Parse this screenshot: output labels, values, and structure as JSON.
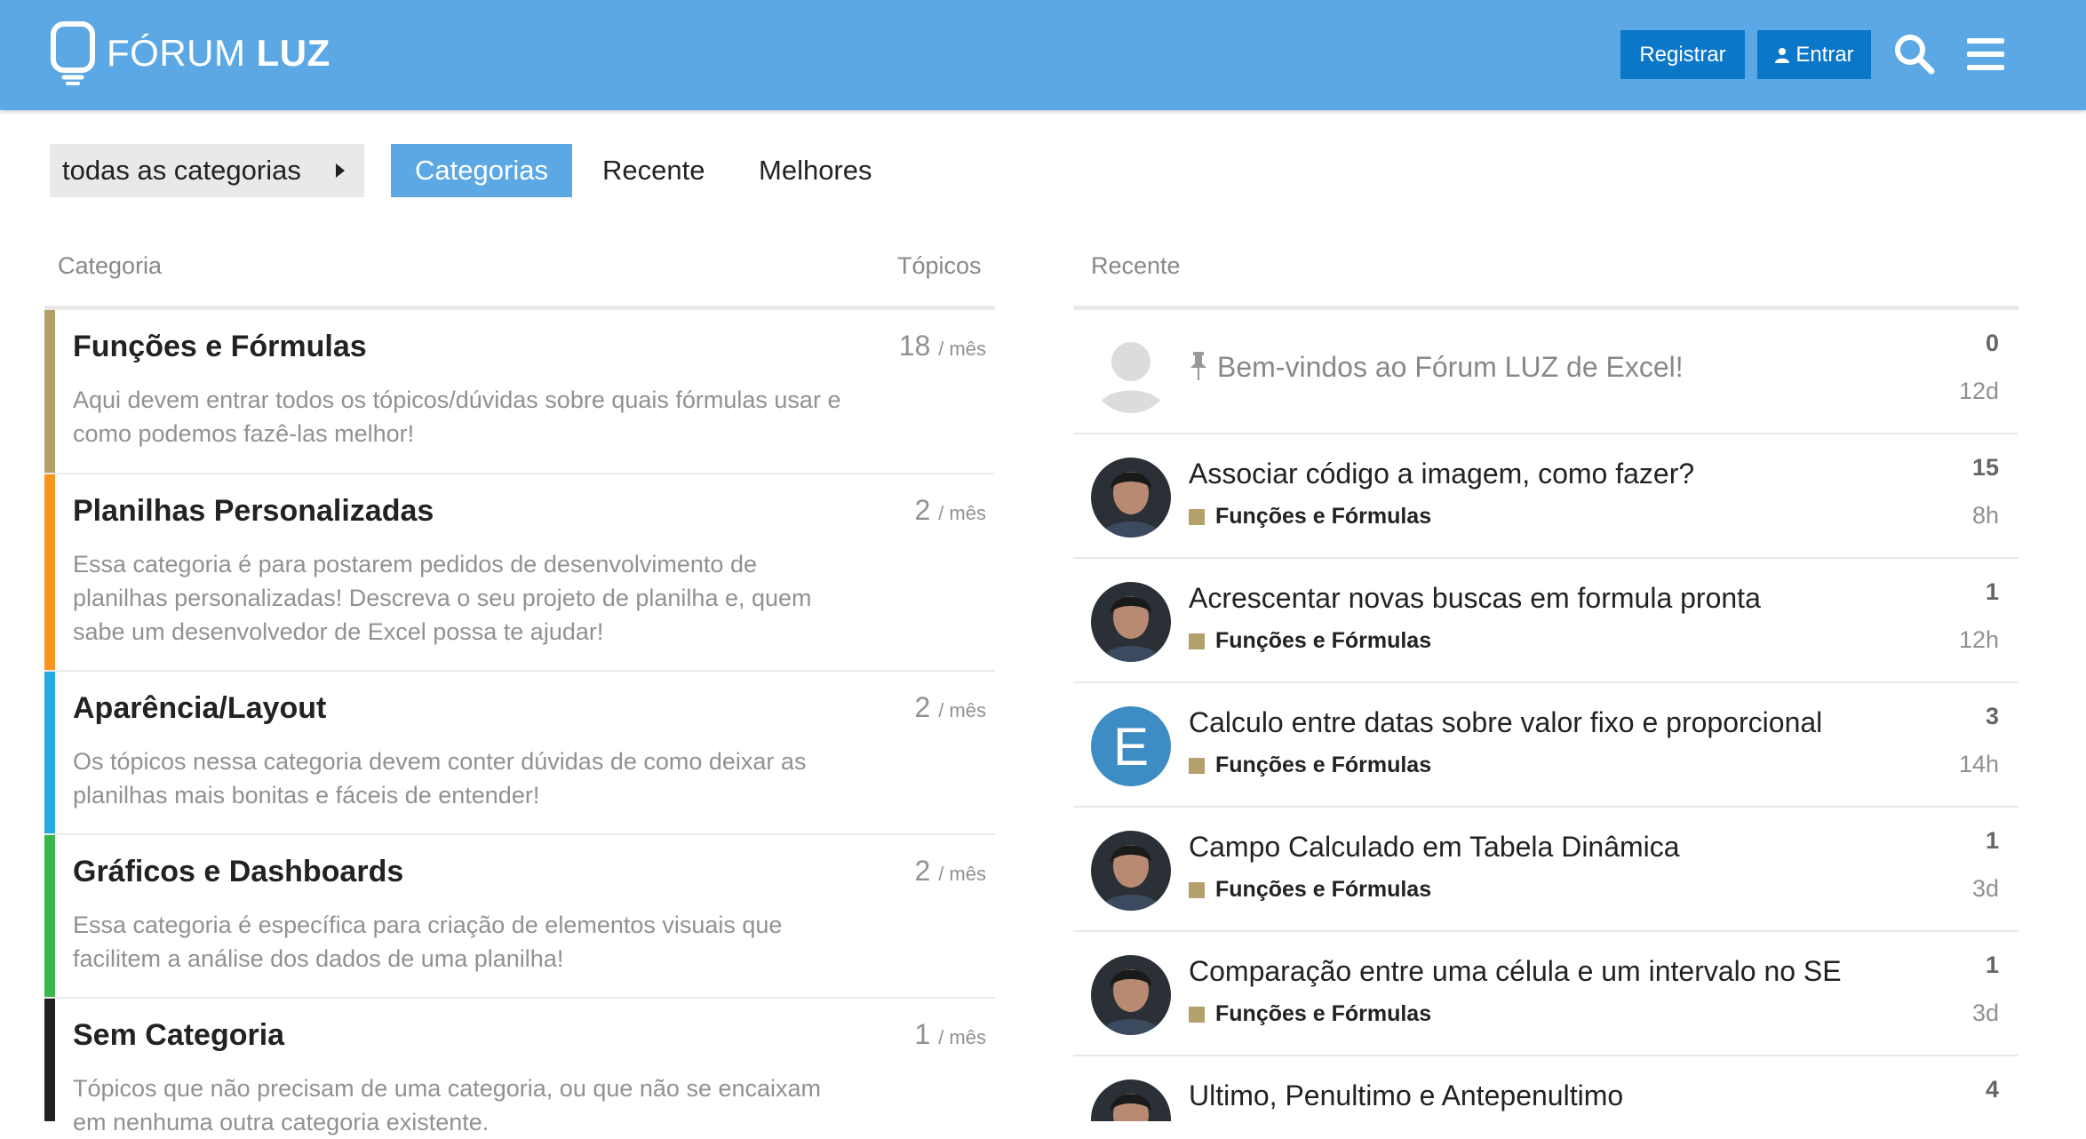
{
  "header": {
    "logo_text_light": "FÓRUM",
    "logo_text_bold": "LUZ",
    "register_label": "Registrar",
    "login_label": "Entrar",
    "brand_color": "#5ba8e4",
    "button_color": "#0b77c8",
    "icons": [
      "bulb-logo-icon",
      "user-icon",
      "search-icon",
      "hamburger-menu-icon"
    ]
  },
  "nav": {
    "dropdown_label": "todas as categorias",
    "tabs": [
      {
        "label": "Categorias",
        "active": true
      },
      {
        "label": "Recente",
        "active": false
      },
      {
        "label": "Melhores",
        "active": false
      }
    ]
  },
  "categories": {
    "header_category": "Categoria",
    "header_topics": "Tópicos",
    "per_label": "/ mês",
    "items": [
      {
        "name": "Funções e Fórmulas",
        "color": "#b3a06b",
        "count": "18",
        "description": "Aqui devem entrar todos os tópicos/dúvidas sobre quais fórmulas usar e como podemos fazê-las melhor!"
      },
      {
        "name": "Planilhas Personalizadas",
        "color": "#f7941d",
        "count": "2",
        "description": "Essa categoria é para postarem pedidos de desenvolvimento de planilhas personalizadas! Descreva o seu projeto de planilha e, quem sabe um desenvolvedor de Excel possa te ajudar!"
      },
      {
        "name": "Aparência/Layout",
        "color": "#25aae1",
        "count": "2",
        "description": "Os tópicos nessa categoria devem conter dúvidas de como deixar as planilhas mais bonitas e fáceis de entender!"
      },
      {
        "name": "Gráficos e Dashboards",
        "color": "#3ab54a",
        "count": "2",
        "description": "Essa categoria é específica para criação de elementos visuais que facilitem a análise dos dados de uma planilha!"
      },
      {
        "name": "Sem Categoria",
        "color": "#231f20",
        "count": "1",
        "description": "Tópicos que não precisam de uma categoria, ou que não se encaixam em nenhuma outra categoria existente."
      }
    ]
  },
  "recent": {
    "header": "Recente",
    "topics": [
      {
        "title": "Bem-vindos ao Fórum LUZ de Excel!",
        "pinned": true,
        "category": "",
        "replies": "0",
        "age": "12d",
        "avatar": "default"
      },
      {
        "title": "Associar código a imagem, como fazer?",
        "pinned": false,
        "category": "Funções e Fórmulas",
        "replies": "15",
        "age": "8h",
        "avatar": "photo"
      },
      {
        "title": "Acrescentar novas buscas em formula pronta",
        "pinned": false,
        "category": "Funções e Fórmulas",
        "replies": "1",
        "age": "12h",
        "avatar": "photo"
      },
      {
        "title": "Calculo entre datas sobre valor fixo e proporcional",
        "pinned": false,
        "category": "Funções e Fórmulas",
        "replies": "3",
        "age": "14h",
        "avatar": "letter",
        "letter": "E"
      },
      {
        "title": "Campo Calculado em Tabela Dinâmica",
        "pinned": false,
        "category": "Funções e Fórmulas",
        "replies": "1",
        "age": "3d",
        "avatar": "photo"
      },
      {
        "title": "Comparação entre uma célula e um intervalo no SE",
        "pinned": false,
        "category": "Funções e Fórmulas",
        "replies": "1",
        "age": "3d",
        "avatar": "photo"
      },
      {
        "title": "Ultimo, Penultimo e Antepenultimo",
        "pinned": false,
        "category": "",
        "replies": "4",
        "age": "",
        "avatar": "photo"
      }
    ]
  }
}
